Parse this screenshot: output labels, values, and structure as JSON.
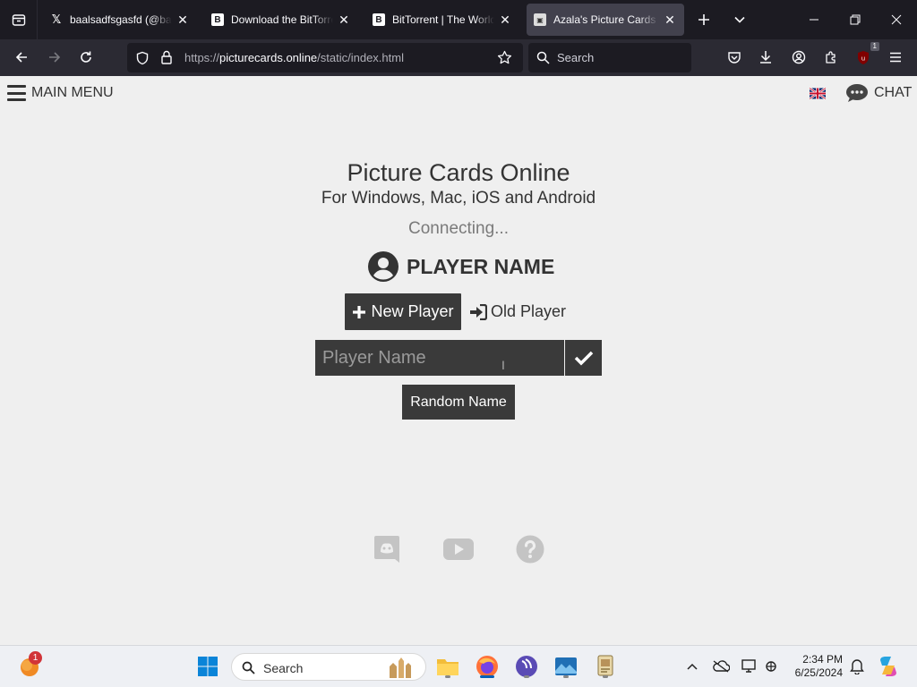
{
  "browser": {
    "tabs": [
      {
        "title": "baalsadfsgasfd (@baal",
        "favicon": "x-logo-icon",
        "active": false
      },
      {
        "title": "Download the BitTorrent",
        "favicon": "bittorrent-icon",
        "active": false
      },
      {
        "title": "BitTorrent | The World's",
        "favicon": "bittorrent-icon",
        "active": false
      },
      {
        "title": "Azala's Picture Cards O",
        "favicon": "picture-cards-icon",
        "active": true
      }
    ],
    "url_prefix": "https://",
    "url_host": "picturecards.online",
    "url_path": "/static/index.html",
    "search_placeholder": "Search",
    "extension_badge": "1"
  },
  "page": {
    "main_menu_label": "MAIN MENU",
    "chat_label": "CHAT",
    "title": "Picture Cards Online",
    "subtitle": "For Windows, Mac, iOS and Android",
    "status": "Connecting...",
    "player_heading": "PLAYER NAME",
    "new_player_label": "New Player",
    "old_player_label": "Old Player",
    "name_placeholder": "Player Name",
    "random_name_label": "Random Name",
    "social": [
      "discord-icon",
      "youtube-icon",
      "help-icon"
    ]
  },
  "taskbar": {
    "search_placeholder": "Search",
    "notification_count": "1",
    "time": "2:34 PM",
    "date": "6/25/2024"
  },
  "colors": {
    "page_bg": "#efefef",
    "button_bg": "#3a3a3a",
    "text_dark": "#333333",
    "status_gray": "#7a7a7a",
    "chrome_dark": "#1c1b22",
    "toolbar": "#2b2a33"
  }
}
